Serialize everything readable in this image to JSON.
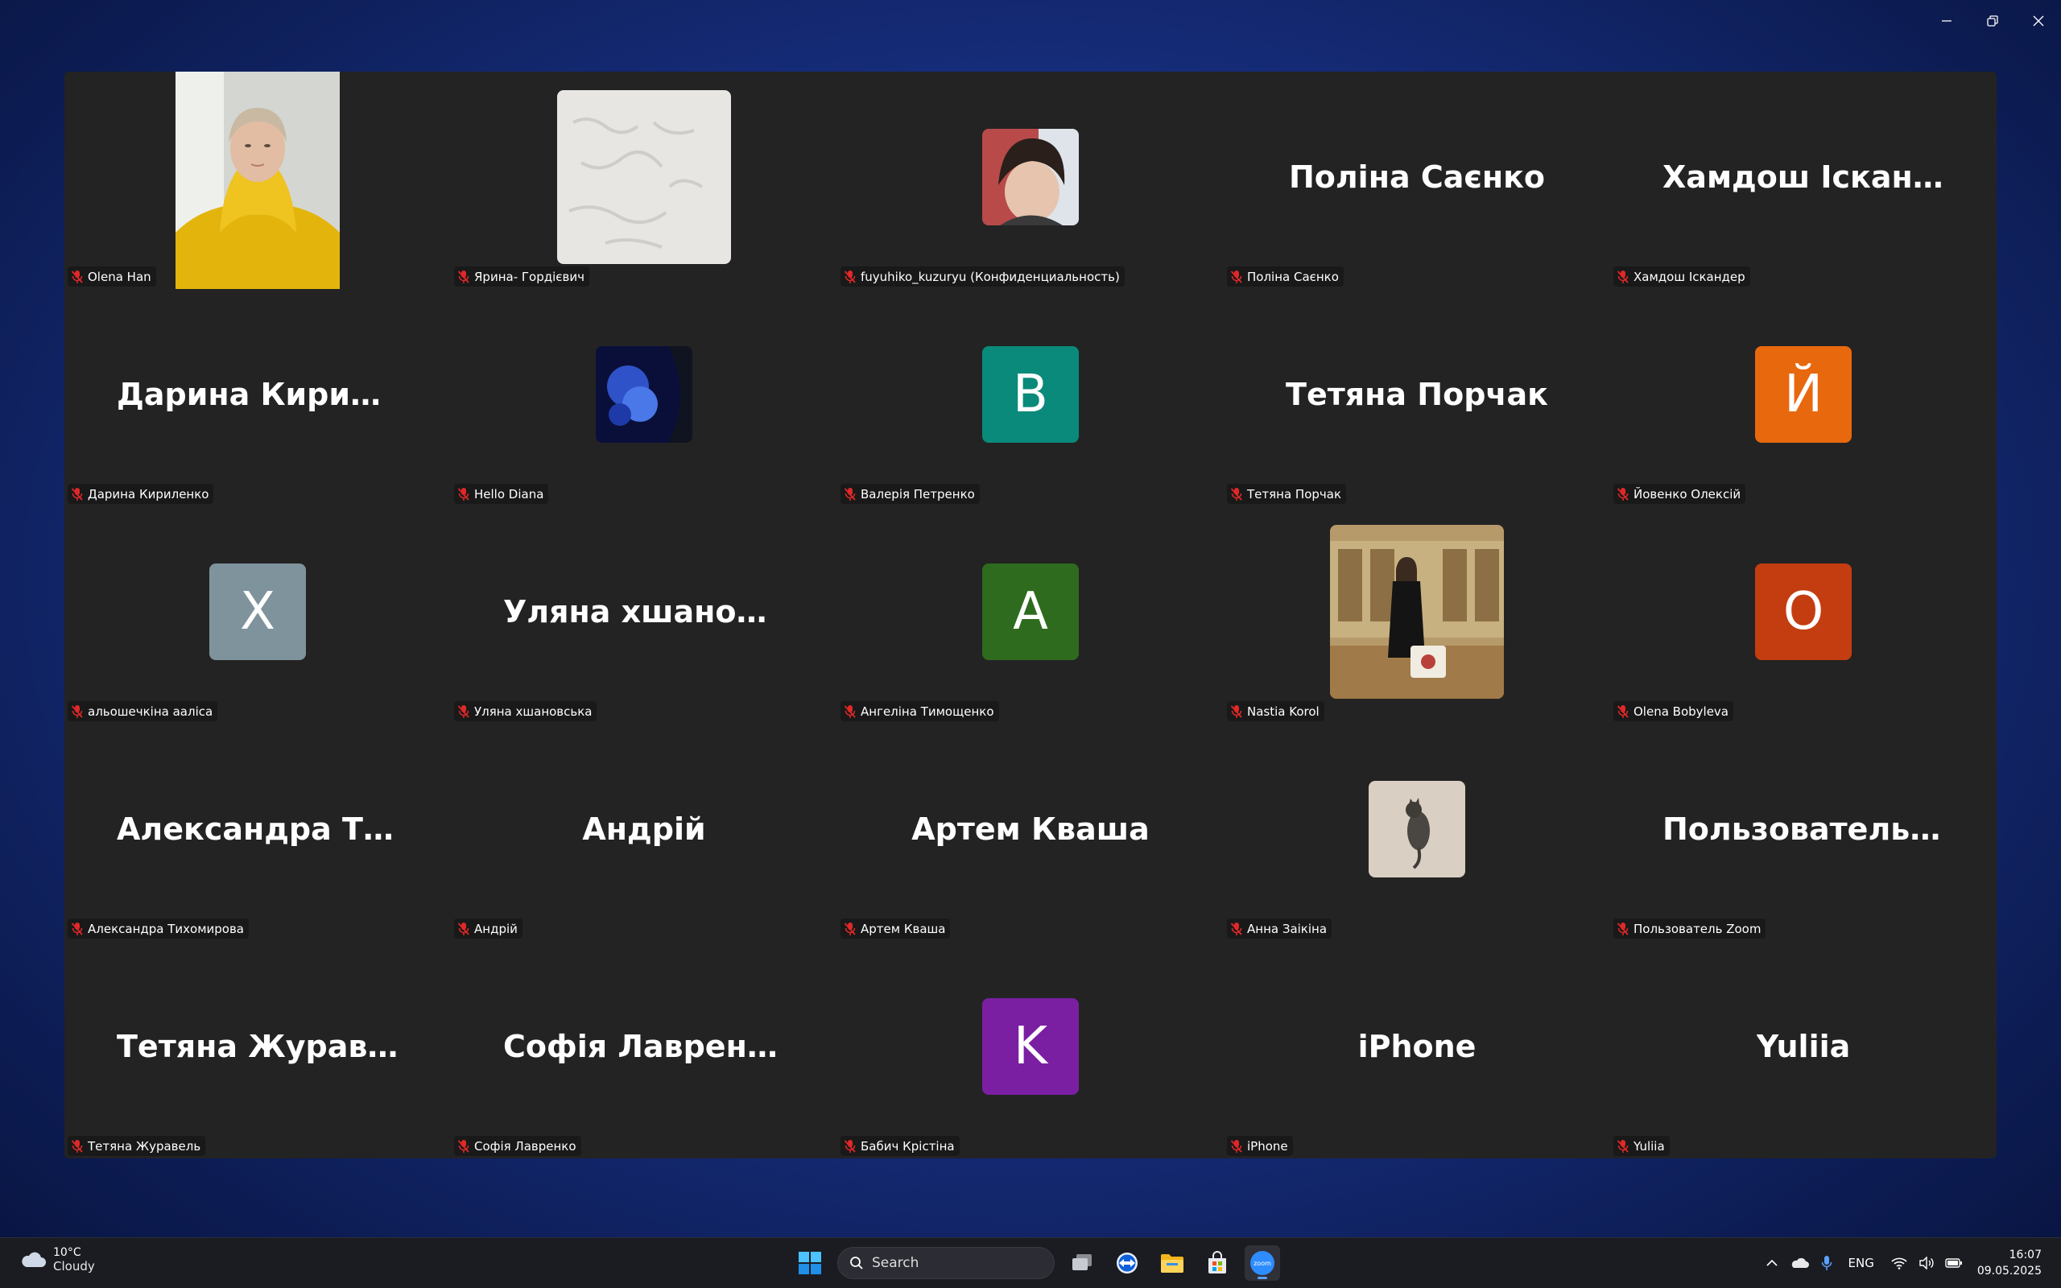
{
  "window": {
    "controls": [
      "minimize",
      "restore",
      "close"
    ]
  },
  "gallery": {
    "tiles": [
      {
        "label": "Olena Han",
        "display": "video"
      },
      {
        "label": "Ярина- Гордієвич",
        "display": "photo"
      },
      {
        "label": "fuyuhiko_kuzuryu (Конфиденциальность)",
        "display": "photo"
      },
      {
        "label": "Поліна Саєнко",
        "display": "name",
        "big_name": "Поліна Саєнко"
      },
      {
        "label": "Хамдош Іскандер",
        "display": "name",
        "big_name": "Хамдош Іскандер"
      },
      {
        "label": "Дарина Кириленко",
        "display": "name",
        "big_name": "Дарина  Кириленко"
      },
      {
        "label": "Hello Diana",
        "display": "photo"
      },
      {
        "label": "Валерія Петренко",
        "display": "avatar",
        "initial": "B",
        "color": "#0a8a7a"
      },
      {
        "label": "Тетяна Порчак",
        "display": "name",
        "big_name": "Тетяна Порчак"
      },
      {
        "label": "Йовенко Олексій",
        "display": "avatar",
        "initial": "Й",
        "color": "#e8680e"
      },
      {
        "label": "альошечкіна ааліса",
        "display": "avatar",
        "initial": "X",
        "color": "#7f939d"
      },
      {
        "label": "Уляна хшановська",
        "display": "name",
        "big_name": "Уляна  хшановська"
      },
      {
        "label": "Ангеліна Тимощенко",
        "display": "avatar",
        "initial": "A",
        "color": "#2e6b1e"
      },
      {
        "label": "Nastia Korol",
        "display": "photo"
      },
      {
        "label": "Olena Bobyleva",
        "display": "avatar",
        "initial": "O",
        "color": "#c43d10"
      },
      {
        "label": "Александра Тихомирова",
        "display": "name",
        "big_name": "Александра  Тихомирова"
      },
      {
        "label": "Андрій",
        "display": "name",
        "big_name": "Андрій"
      },
      {
        "label": "Артем Кваша",
        "display": "name",
        "big_name": "Артем Кваша"
      },
      {
        "label": "Анна Заікіна",
        "display": "photo"
      },
      {
        "label": "Пользователь Zoom",
        "display": "name",
        "big_name": "Пользователь Zoom"
      },
      {
        "label": "Тетяна Журавель",
        "display": "name",
        "big_name": "Тетяна Журавель"
      },
      {
        "label": "Софія Лавренко",
        "display": "name",
        "big_name": "Софія Лавренко"
      },
      {
        "label": "Бабич Крістіна",
        "display": "avatar",
        "initial": "K",
        "color": "#7a1fa2"
      },
      {
        "label": "iPhone",
        "display": "name",
        "big_name": "iPhone"
      },
      {
        "label": "Yuliia",
        "display": "name",
        "big_name": "Yuliia"
      }
    ]
  },
  "taskbar": {
    "weather": {
      "temp": "10°C",
      "condition": "Cloudy"
    },
    "search_placeholder": "Search",
    "apps": [
      "task-view",
      "teamviewer",
      "file-explorer",
      "microsoft-store",
      "zoom"
    ],
    "tray": {
      "lang": "ENG",
      "time": "16:07",
      "date": "09.05.2025"
    }
  }
}
